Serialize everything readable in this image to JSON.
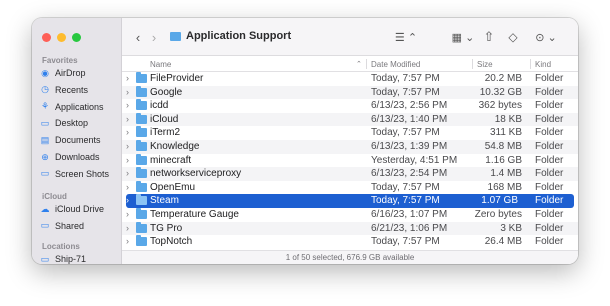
{
  "sidebar": {
    "favorites_header": "Favorites",
    "favorites": [
      {
        "label": "AirDrop",
        "icon": "airdrop-icon"
      },
      {
        "label": "Recents",
        "icon": "clock-icon"
      },
      {
        "label": "Applications",
        "icon": "applications-icon"
      },
      {
        "label": "Desktop",
        "icon": "desktop-icon"
      },
      {
        "label": "Documents",
        "icon": "document-icon"
      },
      {
        "label": "Downloads",
        "icon": "download-icon"
      },
      {
        "label": "Screen Shots",
        "icon": "folder-icon"
      }
    ],
    "icloud_header": "iCloud",
    "icloud": [
      {
        "label": "iCloud Drive",
        "icon": "cloud-icon"
      },
      {
        "label": "Shared",
        "icon": "shared-folder-icon"
      }
    ],
    "locations_header": "Locations",
    "locations": [
      {
        "label": "Ship-71",
        "icon": "disk-icon"
      }
    ]
  },
  "toolbar": {
    "title": "Application Support",
    "back_icon": "chevron-left-icon",
    "forward_icon": "chevron-right-icon",
    "view_icon": "list-view-icon",
    "group_icon": "grid-view-icon",
    "share_icon": "share-icon",
    "tag_icon": "tag-icon",
    "more_icon": "ellipsis-icon",
    "search_icon": "search-icon"
  },
  "columns": {
    "name": "Name",
    "date": "Date Modified",
    "size": "Size",
    "kind": "Kind"
  },
  "files": [
    {
      "name": "FileProvider",
      "date": "Today, 7:57 PM",
      "size": "20.2 MB",
      "kind": "Folder"
    },
    {
      "name": "Google",
      "date": "Today, 7:57 PM",
      "size": "10.32 GB",
      "kind": "Folder"
    },
    {
      "name": "icdd",
      "date": "6/13/23, 2:56 PM",
      "size": "362 bytes",
      "kind": "Folder"
    },
    {
      "name": "iCloud",
      "date": "6/13/23, 1:40 PM",
      "size": "18 KB",
      "kind": "Folder"
    },
    {
      "name": "iTerm2",
      "date": "Today, 7:57 PM",
      "size": "311 KB",
      "kind": "Folder"
    },
    {
      "name": "Knowledge",
      "date": "6/13/23, 1:39 PM",
      "size": "54.8 MB",
      "kind": "Folder"
    },
    {
      "name": "minecraft",
      "date": "Yesterday, 4:51 PM",
      "size": "1.16 GB",
      "kind": "Folder"
    },
    {
      "name": "networkserviceproxy",
      "date": "6/13/23, 2:54 PM",
      "size": "1.4 MB",
      "kind": "Folder"
    },
    {
      "name": "OpenEmu",
      "date": "Today, 7:57 PM",
      "size": "168 MB",
      "kind": "Folder"
    },
    {
      "name": "Steam",
      "date": "Today, 7:57 PM",
      "size": "1.07 GB",
      "kind": "Folder",
      "selected": true
    },
    {
      "name": "Temperature Gauge",
      "date": "6/16/23, 1:07 PM",
      "size": "Zero bytes",
      "kind": "Folder"
    },
    {
      "name": "TG Pro",
      "date": "6/21/23, 1:06 PM",
      "size": "3 KB",
      "kind": "Folder"
    },
    {
      "name": "TopNotch",
      "date": "Today, 7:57 PM",
      "size": "26.4 MB",
      "kind": "Folder"
    }
  ],
  "status": "1 of 50 selected, 676.9 GB available",
  "colors": {
    "selection": "#1d5fd1",
    "accent": "#2f80ed",
    "folder": "#5aa8e8"
  }
}
